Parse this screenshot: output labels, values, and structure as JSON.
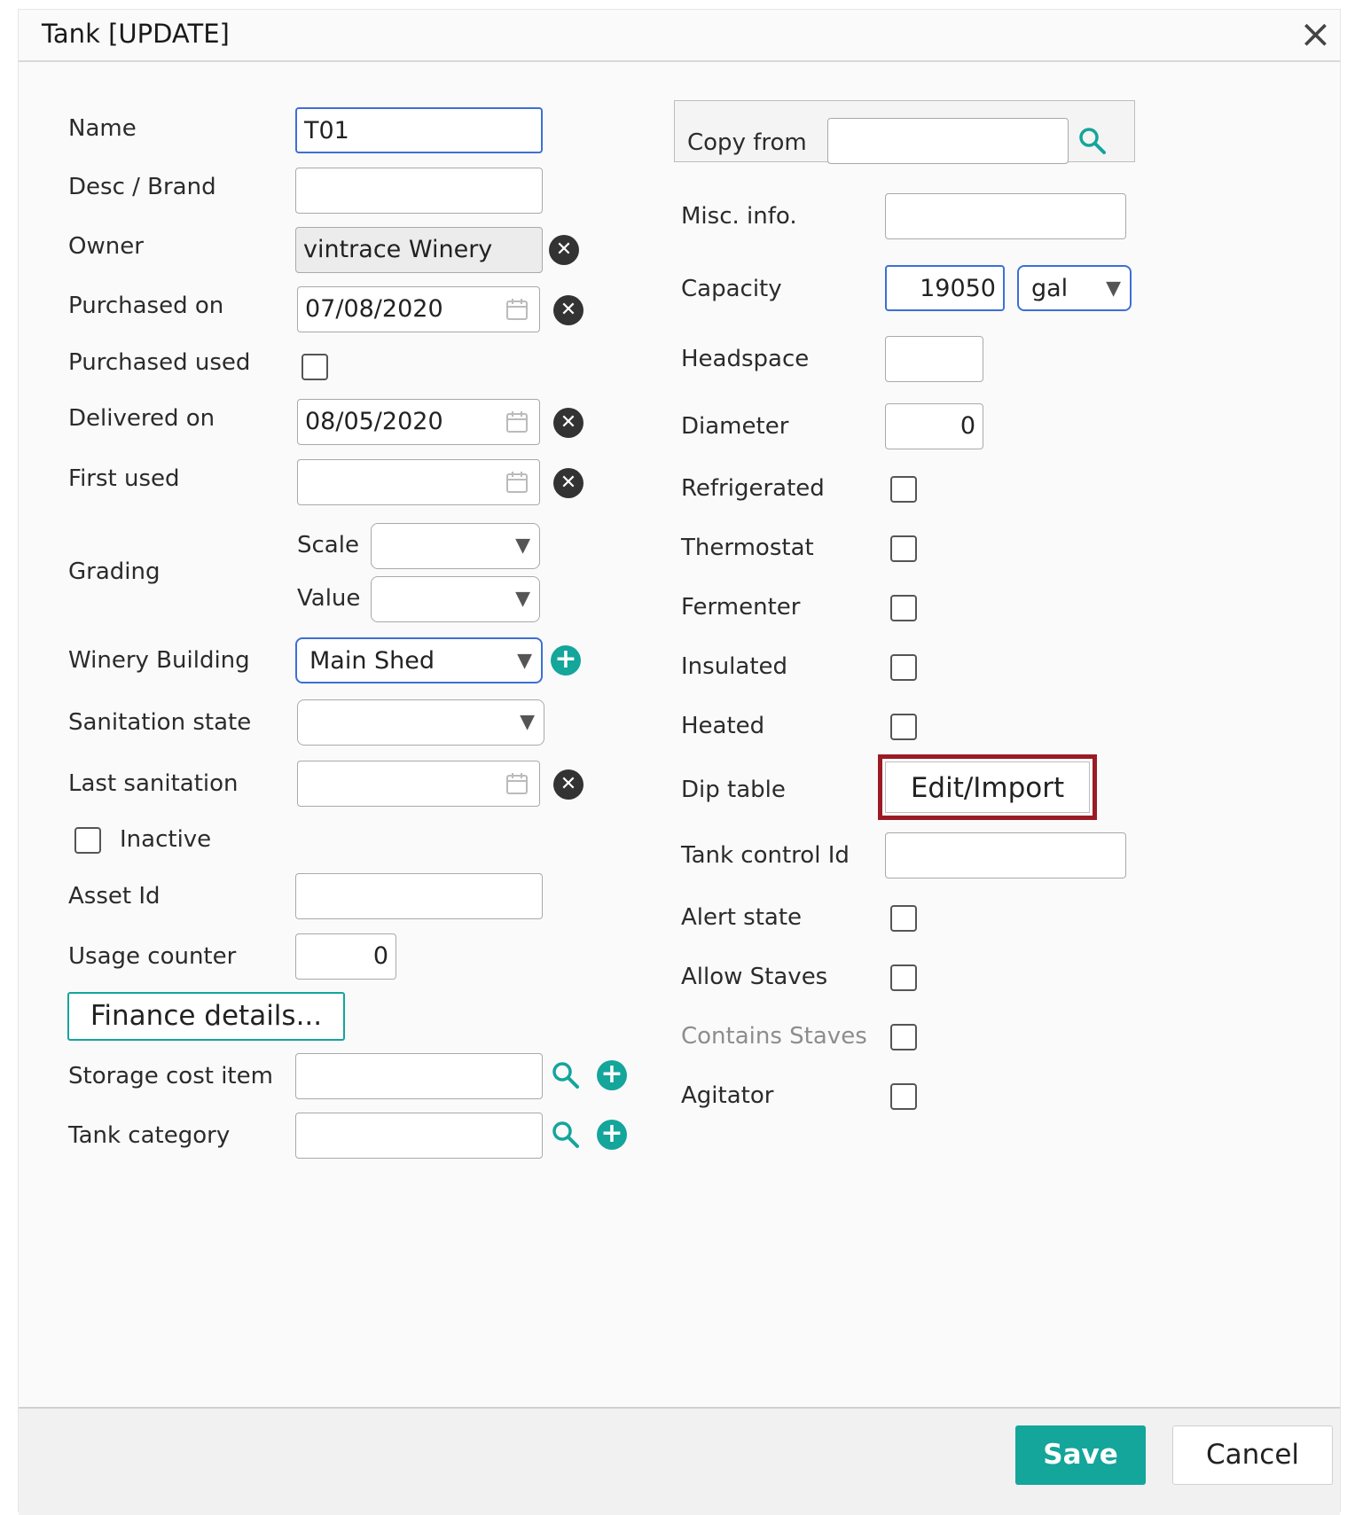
{
  "dialog": {
    "title": "Tank [UPDATE]",
    "close": "×"
  },
  "left": {
    "name": {
      "label": "Name",
      "value": "T01"
    },
    "desc": {
      "label": "Desc / Brand",
      "value": ""
    },
    "owner": {
      "label": "Owner",
      "value": "vintrace Winery"
    },
    "purchased_on": {
      "label": "Purchased on",
      "value": "07/08/2020"
    },
    "purchased_used": {
      "label": "Purchased used"
    },
    "delivered_on": {
      "label": "Delivered on",
      "value": "08/05/2020"
    },
    "first_used": {
      "label": "First used",
      "value": ""
    },
    "grading": {
      "label": "Grading",
      "scale_label": "Scale",
      "value_label": "Value",
      "scale": "",
      "value": ""
    },
    "winery_building": {
      "label": "Winery Building",
      "value": "Main Shed"
    },
    "sanitation_state": {
      "label": "Sanitation state",
      "value": ""
    },
    "last_sanitation": {
      "label": "Last sanitation",
      "value": ""
    },
    "inactive": {
      "label": "Inactive"
    },
    "asset_id": {
      "label": "Asset Id",
      "value": ""
    },
    "usage_counter": {
      "label": "Usage counter",
      "value": "0"
    },
    "finance_button": "Finance details...",
    "storage_cost_item": {
      "label": "Storage cost item",
      "value": ""
    },
    "tank_category": {
      "label": "Tank category",
      "value": ""
    }
  },
  "right": {
    "copy_from": {
      "label": "Copy from",
      "value": ""
    },
    "misc_info": {
      "label": "Misc. info.",
      "value": ""
    },
    "capacity": {
      "label": "Capacity",
      "value": "19050",
      "unit": "gal"
    },
    "headspace": {
      "label": "Headspace",
      "value": ""
    },
    "diameter": {
      "label": "Diameter",
      "value": "0"
    },
    "refrigerated": {
      "label": "Refrigerated"
    },
    "thermostat": {
      "label": "Thermostat"
    },
    "fermenter": {
      "label": "Fermenter"
    },
    "insulated": {
      "label": "Insulated"
    },
    "heated": {
      "label": "Heated"
    },
    "dip_table": {
      "label": "Dip table",
      "button": "Edit/Import"
    },
    "tank_control_id": {
      "label": "Tank control Id",
      "value": ""
    },
    "alert_state": {
      "label": "Alert state"
    },
    "allow_staves": {
      "label": "Allow Staves"
    },
    "contains_staves": {
      "label": "Contains Staves"
    },
    "agitator": {
      "label": "Agitator"
    }
  },
  "footer": {
    "save": "Save",
    "cancel": "Cancel"
  },
  "colors": {
    "accent": "#14a59b",
    "focus": "#3d6fd6",
    "highlight": "#9b1b24"
  },
  "icons": [
    "close-icon",
    "calendar-icon",
    "clear-icon",
    "plus-icon",
    "search-icon",
    "dropdown-arrow-icon"
  ]
}
